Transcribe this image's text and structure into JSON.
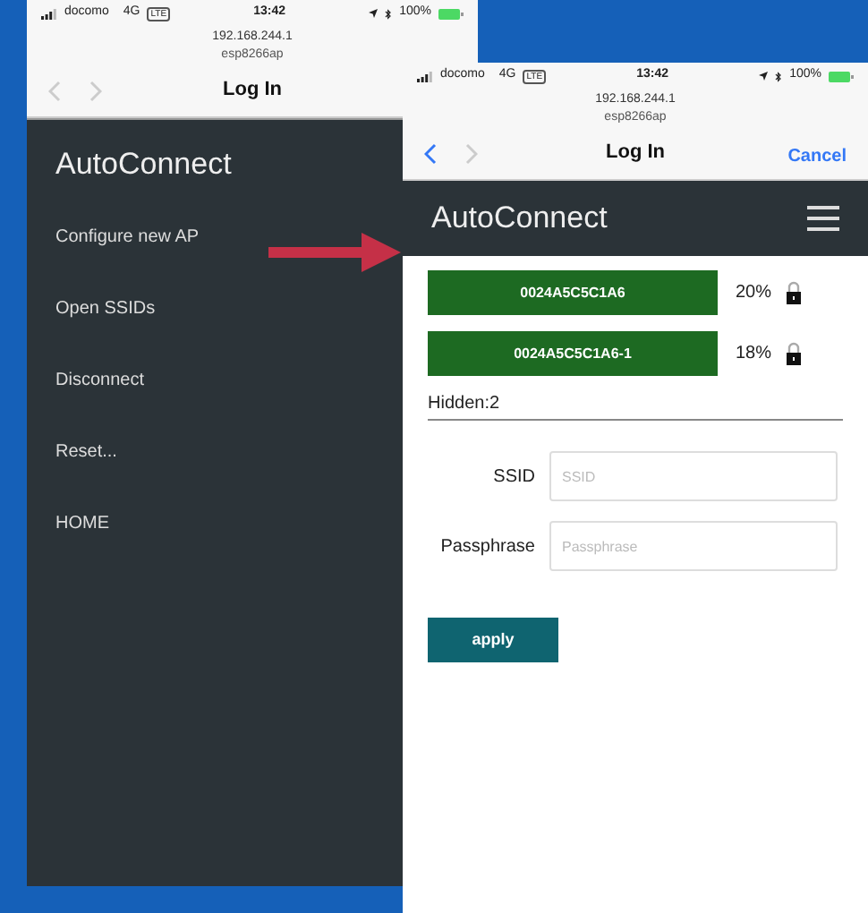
{
  "left_screen": {
    "status_bar": {
      "carrier": "docomo",
      "network": "4G",
      "network_badge": "LTE",
      "time": "13:42",
      "battery": "100%"
    },
    "address": {
      "host": "192.168.244.1",
      "ssid": "esp8266ap"
    },
    "nav": {
      "back_enabled": false,
      "forward_enabled": false,
      "title": "Log In"
    },
    "brand": "AutoConnect",
    "menu": [
      {
        "label": "Configure new AP"
      },
      {
        "label": "Open SSIDs"
      },
      {
        "label": "Disconnect"
      },
      {
        "label": "Reset..."
      },
      {
        "label": "HOME"
      }
    ]
  },
  "right_screen": {
    "status_bar": {
      "carrier": "docomo",
      "network": "4G",
      "network_badge": "LTE",
      "time": "13:42",
      "battery": "100%"
    },
    "address": {
      "host": "192.168.244.1",
      "ssid": "esp8266ap"
    },
    "nav": {
      "back_enabled": true,
      "forward_enabled": false,
      "title": "Log In",
      "cancel": "Cancel"
    },
    "brand": "AutoConnect",
    "access_points": [
      {
        "ssid": "0024A5C5C1A6",
        "signal": "20%",
        "locked": true
      },
      {
        "ssid": "0024A5C5C1A6-1",
        "signal": "18%",
        "locked": true
      }
    ],
    "hidden": "Hidden:2",
    "fields": [
      {
        "label": "SSID",
        "placeholder": "SSID"
      },
      {
        "label": "Passphrase",
        "placeholder": "Passphrase"
      }
    ],
    "apply": "apply"
  }
}
